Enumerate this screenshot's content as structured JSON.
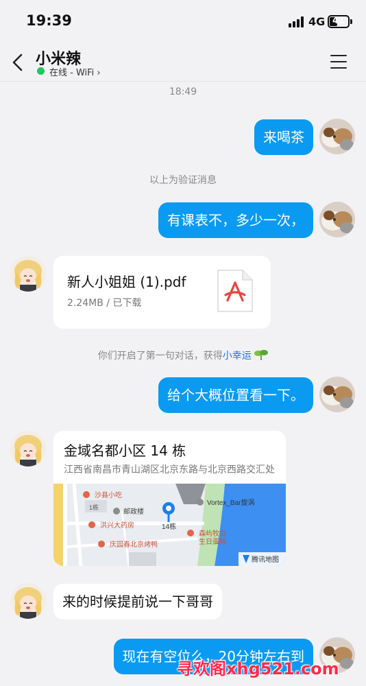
{
  "status_bar": {
    "time": "19:39",
    "network": "4G",
    "battery": "41",
    "battery_level_percent": 41
  },
  "header": {
    "title": "小米辣",
    "status": "在线 - WiFi ›",
    "back_icon": "chevron-left-icon",
    "menu_icon": "hamburger-menu-icon"
  },
  "messages": {
    "timestamp": "18:49",
    "m1": "来喝茶",
    "verify_note": "以上为验证消息",
    "m2": "有课表不，多少一次，",
    "file": {
      "name": "新人小姐姐 (1).pdf",
      "meta": "2.24MB / 已下载",
      "icon": "pdf-file-icon"
    },
    "luck_note_prefix": "你们开启了第一句对话，获得",
    "luck_note_link": "小幸运",
    "luck_icon": "sprout-icon",
    "m3": "给个大概位置看一下。",
    "location": {
      "name": "金域名都小区 14 栋",
      "address": "江西省南昌市青山湖区北京东路与北京西路交汇处",
      "map_labels": {
        "poi1": "沙县小吃",
        "poi2": "邮政楼",
        "poi3": "洪兴大药房",
        "poi4": "庆园春北京烤鸭",
        "poi5": "Vortex_Bar旋涡",
        "poi6": "森屿牧白",
        "poi6b": "生日蛋糕",
        "building": "1栋",
        "pin_label": "14栋",
        "brand": "腾讯地图"
      }
    },
    "m4": "来的时候提前说一下哥哥",
    "m5": "现在有空位么，20分钟左右到"
  },
  "watermark": "寻欢阁xhg521.com",
  "colors": {
    "self_bubble": "#0a9af2",
    "other_bubble": "#ffffff",
    "background": "#f2f2f5",
    "online": "#22c55e",
    "link": "#1a73e8"
  }
}
